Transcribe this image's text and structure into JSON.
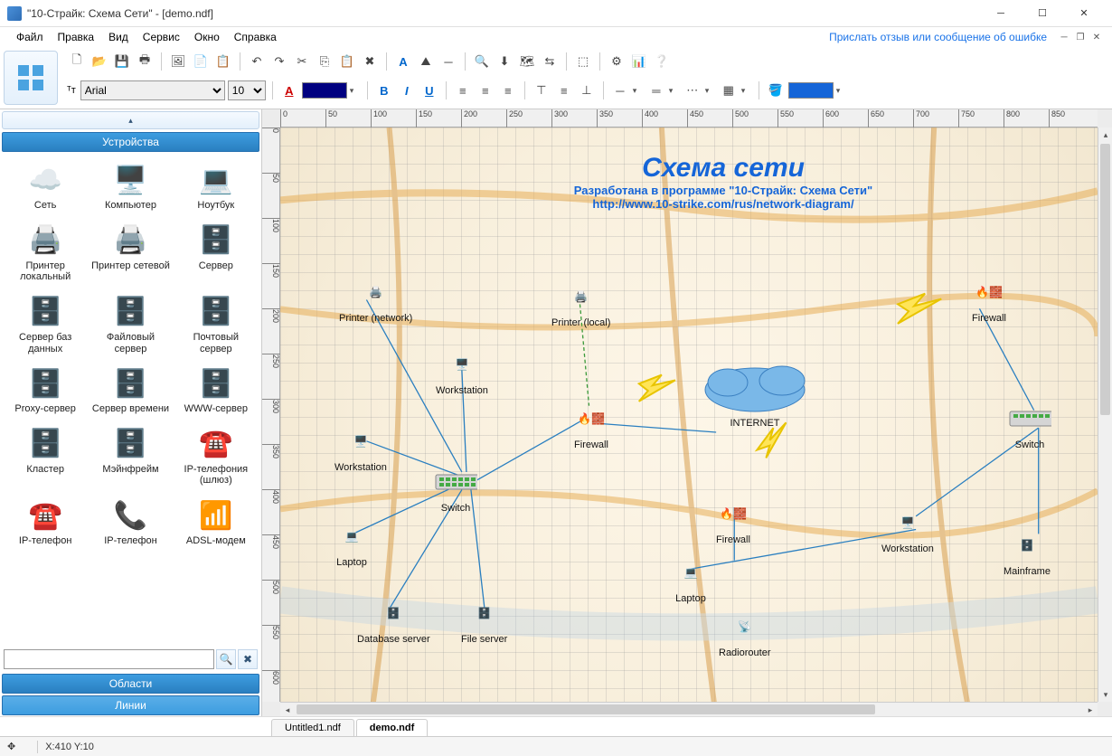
{
  "window": {
    "title": "\"10-Страйк: Схема Сети\" - [demo.ndf]",
    "feedback_link": "Прислать отзыв или сообщение об ошибке"
  },
  "menu": [
    "Файл",
    "Правка",
    "Вид",
    "Сервис",
    "Окно",
    "Справка"
  ],
  "font": {
    "name": "Arial",
    "size": "10"
  },
  "sidebar": {
    "header_devices": "Устройства",
    "header_areas": "Области",
    "header_lines": "Линии",
    "search_placeholder": "",
    "devices": [
      "Сеть",
      "Компьютер",
      "Ноутбук",
      "Принтер локальный",
      "Принтер сетевой",
      "Сервер",
      "Сервер баз данных",
      "Файловый сервер",
      "Почтовый сервер",
      "Proxy-сервер",
      "Сервер времени",
      "WWW-сервер",
      "Кластер",
      "Мэйнфрейм",
      "IP-телефония (шлюз)",
      "IP-телефон",
      "IP-телефон",
      "ADSL-модем"
    ]
  },
  "diagram": {
    "title": "Схема сети",
    "subtitle": "Разработана в программе \"10-Страйк: Схема Сети\"",
    "url": "http://www.10-strike.com/rus/network-diagram/",
    "nodes": {
      "printer_network": "Printer (network)",
      "printer_local": "Printer (local)",
      "workstation1": "Workstation",
      "workstation2": "Workstation",
      "firewall1": "Firewall",
      "firewall2": "Firewall",
      "firewall3": "Firewall",
      "internet": "INTERNET",
      "switch1": "Switch",
      "switch2": "Switch",
      "laptop1": "Laptop",
      "laptop2": "Laptop",
      "db_server": "Database server",
      "file_server": "File server",
      "workstation3": "Workstation",
      "mainframe": "Mainframe",
      "radiorouter": "Radiorouter"
    }
  },
  "tabs": {
    "tab1": "Untitled1.ndf",
    "tab2": "demo.ndf"
  },
  "status": {
    "coords": "X:410  Y:10"
  },
  "ruler_h": [
    "0",
    "50",
    "100",
    "150",
    "200",
    "250",
    "300",
    "350",
    "400",
    "450",
    "500",
    "550",
    "600",
    "650",
    "700",
    "750",
    "800",
    "850"
  ],
  "ruler_v": [
    "0",
    "50",
    "100",
    "150",
    "200",
    "250",
    "300",
    "350",
    "400",
    "450",
    "500",
    "550",
    "600"
  ]
}
